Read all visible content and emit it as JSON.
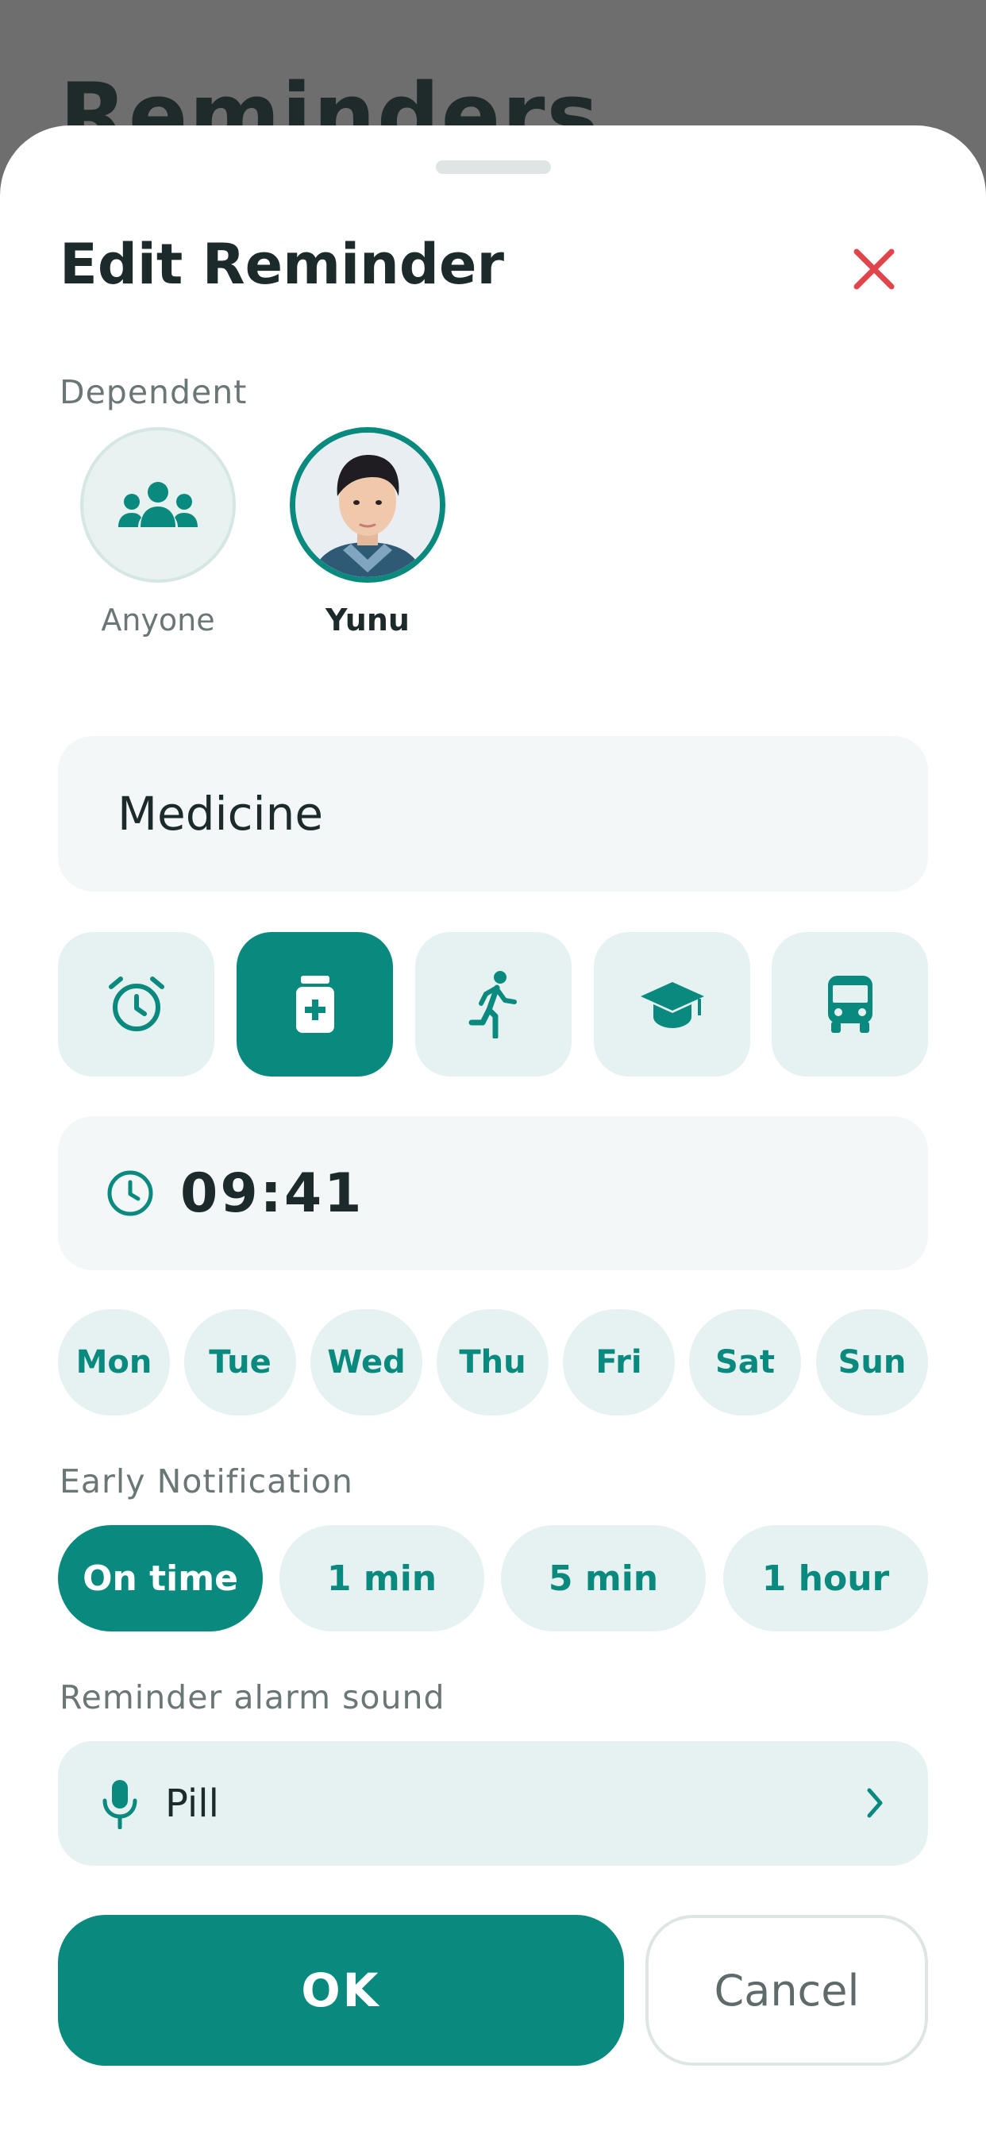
{
  "background": {
    "title": "Reminders"
  },
  "sheet": {
    "title": "Edit Reminder",
    "close_icon": "close-icon"
  },
  "dependent": {
    "label": "Dependent",
    "options": [
      {
        "name": "Anyone",
        "icon": "group-icon",
        "selected": false
      },
      {
        "name": "Yunu",
        "icon": "avatar-photo",
        "selected": true
      }
    ]
  },
  "reminder": {
    "title_value": "Medicine"
  },
  "categories": [
    {
      "icon": "alarm-clock-icon",
      "selected": false
    },
    {
      "icon": "medicine-bottle-icon",
      "selected": true
    },
    {
      "icon": "running-icon",
      "selected": false
    },
    {
      "icon": "graduation-cap-icon",
      "selected": false
    },
    {
      "icon": "bus-icon",
      "selected": false
    }
  ],
  "time": {
    "icon": "clock-icon",
    "value": "09:41"
  },
  "days": [
    "Mon",
    "Tue",
    "Wed",
    "Thu",
    "Fri",
    "Sat",
    "Sun"
  ],
  "early_notification": {
    "label": "Early Notification",
    "options": [
      "On time",
      "1 min",
      "5 min",
      "1 hour"
    ],
    "selected": "On time"
  },
  "alarm_sound": {
    "label": "Reminder alarm sound",
    "icon": "microphone-icon",
    "value": "Pill",
    "chevron": "chevron-right-icon"
  },
  "actions": {
    "ok_label": "OK",
    "cancel_label": "Cancel"
  },
  "colors": {
    "accent": "#0a8a7e",
    "accent_light": "#e5f2f1",
    "close_red": "#e0454b",
    "text_dark": "#1c2a2b",
    "text_muted": "#6b7676"
  }
}
